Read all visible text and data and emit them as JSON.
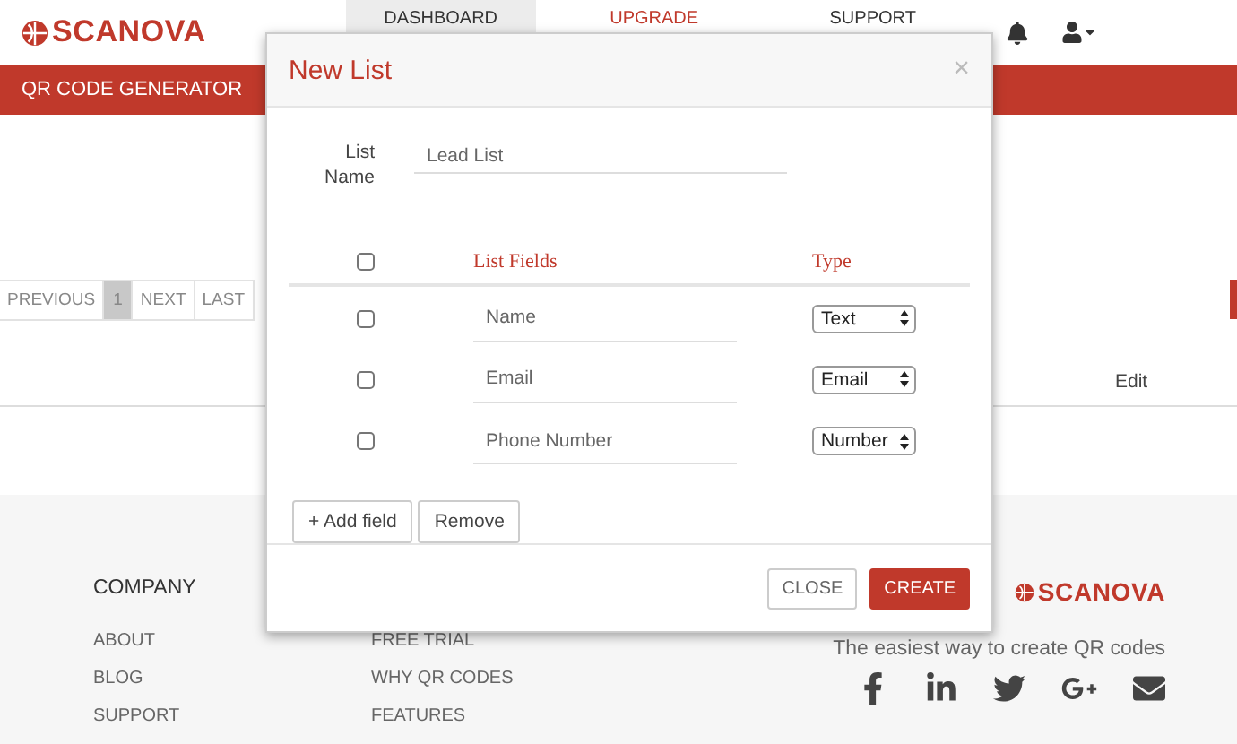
{
  "header": {
    "logo": "SCANOVA",
    "nav": [
      {
        "label": "DASHBOARD",
        "selected": true,
        "kind": "link"
      },
      {
        "label": "UPGRADE",
        "selected": false,
        "kind": "promo"
      },
      {
        "label": "SUPPORT",
        "selected": false,
        "kind": "link"
      }
    ]
  },
  "red_bar": {
    "title": "QR CODE GENERATOR"
  },
  "pagination": [
    {
      "label": "PREVIOUS",
      "selected": false
    },
    {
      "label": "1",
      "selected": true
    },
    {
      "label": "NEXT",
      "selected": false
    },
    {
      "label": "LAST",
      "selected": false
    }
  ],
  "table": {
    "column_edit": "Edit"
  },
  "footer": {
    "company": {
      "heading": "COMPANY",
      "links": [
        "ABOUT",
        "BLOG",
        "SUPPORT"
      ]
    },
    "column_2": {
      "links": [
        "FREE TRIAL",
        "WHY QR CODES",
        "FEATURES"
      ]
    },
    "brand": {
      "logo": "SCANOVA",
      "tagline": "The easiest way to create QR codes"
    }
  },
  "modal": {
    "title": "New List",
    "close_symbol": "×",
    "list_name_label": "List Name",
    "list_name_value": "Lead List",
    "columns": {
      "select_all_checked": false,
      "fields": "List Fields",
      "type": "Type"
    },
    "rows": [
      {
        "checked": false,
        "field": "Name",
        "type": "Text"
      },
      {
        "checked": false,
        "field": "Email",
        "type": "Email"
      },
      {
        "checked": false,
        "field": "Phone Number",
        "type": "Number"
      }
    ],
    "row_buttons": [
      "+ Add field",
      "Remove"
    ],
    "footer_buttons": [
      {
        "label": "CLOSE",
        "kind": "secondary"
      },
      {
        "label": "CREATE",
        "kind": "primary"
      }
    ]
  }
}
